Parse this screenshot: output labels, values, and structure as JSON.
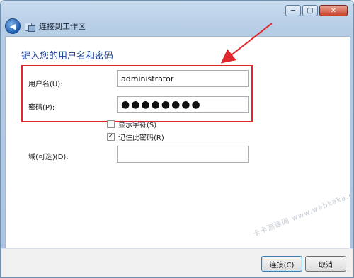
{
  "window": {
    "title": "连接到工作区"
  },
  "titlebar": {
    "minimize": "─",
    "maximize": "▢",
    "close": "✕",
    "back_glyph": "◀"
  },
  "form": {
    "heading": "键入您的用户名和密码",
    "username": {
      "label": "用户名(U):",
      "value": "administrator"
    },
    "password": {
      "label": "密码(P):",
      "value": "●●●●●●●●"
    },
    "show_chars": {
      "label": "显示字符(S)",
      "checked": false
    },
    "remember": {
      "label": "记住此密码(R)",
      "checked": true,
      "mark": "✓"
    },
    "domain": {
      "label": "域(可选)(D):",
      "value": ""
    }
  },
  "buttons": {
    "connect": "连接(C)",
    "cancel": "取消"
  },
  "watermark": "卡卡测速网 www.webkaka.com",
  "colors": {
    "highlight": "#e1262c",
    "heading": "#1b3c8f"
  }
}
